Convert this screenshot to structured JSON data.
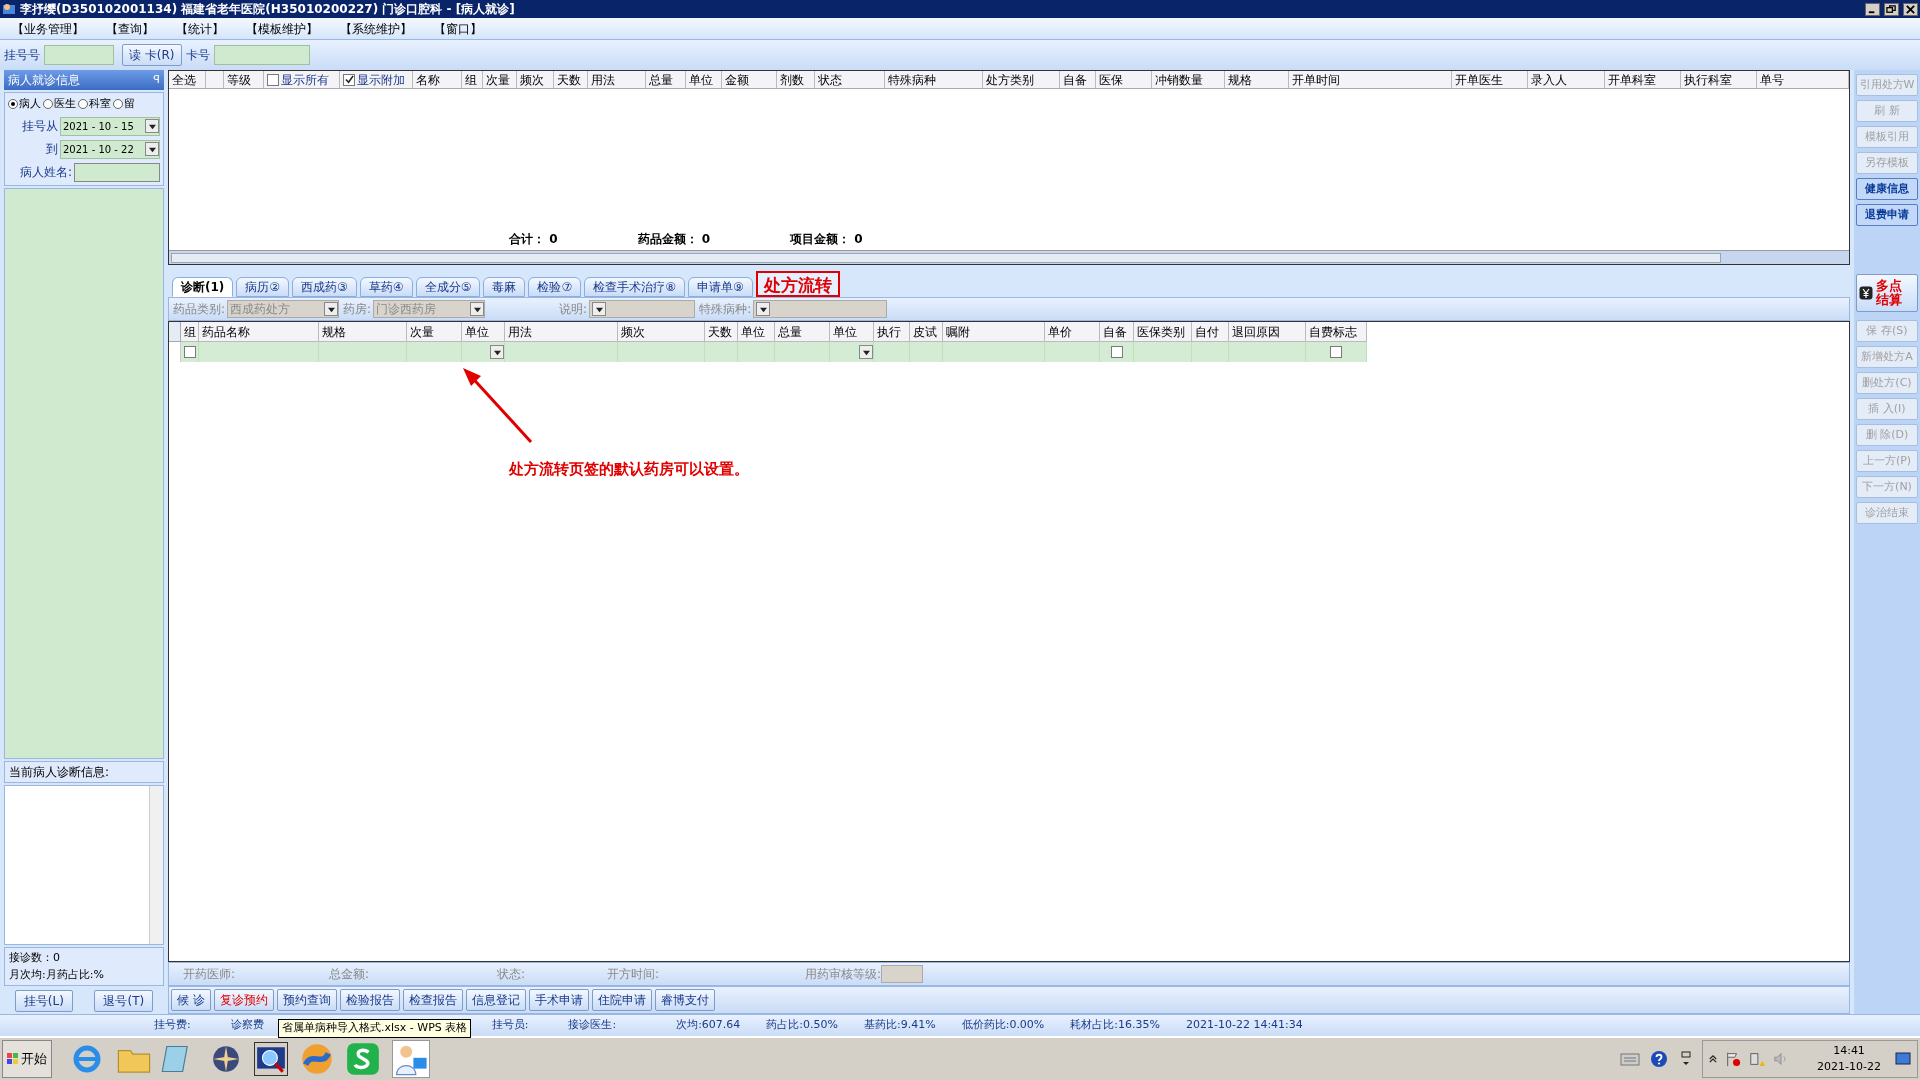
{
  "window": {
    "title": "李抒缨(D350102001134) 福建省老年医院(H35010200227) 门诊口腔科 - [病人就诊]"
  },
  "menu": [
    "【业务管理】",
    "【查询】",
    "【统计】",
    "【模板维护】",
    "【系统维护】",
    "【窗口】"
  ],
  "toolbar": {
    "reg_label": "挂号号",
    "read_card": "读 卡(R)",
    "card_label": "卡号"
  },
  "left_panel": {
    "title": "病人就诊信息",
    "pin": "ꟼ",
    "radios": [
      {
        "label": "病人",
        "selected": true
      },
      {
        "label": "医生",
        "selected": false
      },
      {
        "label": "科室",
        "selected": false
      },
      {
        "label": "留",
        "selected": false
      }
    ],
    "date_from_label": "挂号从",
    "date_from": "2021 - 10 - 15",
    "date_to_label": "到",
    "date_to": "2021 - 10 - 22",
    "name_label": "病人姓名:",
    "diag_title": "当前病人诊断信息:",
    "visits": "接诊数：0",
    "monthly": "月次均:月药占比:%",
    "buttons": [
      "挂号(L)",
      "退号(T)"
    ]
  },
  "top_grid": {
    "columns": [
      {
        "label": "全选",
        "kind": "text"
      },
      {
        "kind": "text"
      },
      {
        "label": "等级",
        "kind": "text"
      },
      {
        "label": "显示所有",
        "kind": "checkbox",
        "checked": false
      },
      {
        "label": "显示附加",
        "kind": "checkbox",
        "checked": true
      },
      {
        "label": "名称",
        "kind": "text"
      },
      {
        "label": "组",
        "kind": "text"
      },
      {
        "label": "次量",
        "kind": "text"
      },
      {
        "label": "频次",
        "kind": "text"
      },
      {
        "label": "天数",
        "kind": "text"
      },
      {
        "label": "用法",
        "kind": "text"
      },
      {
        "label": "总量",
        "kind": "text"
      },
      {
        "label": "单位",
        "kind": "text"
      },
      {
        "label": "金额",
        "kind": "text"
      },
      {
        "label": "剂数",
        "kind": "text"
      },
      {
        "label": "状态",
        "kind": "text"
      },
      {
        "label": "特殊病种",
        "kind": "text"
      },
      {
        "label": "处方类别",
        "kind": "text"
      },
      {
        "label": "自备",
        "kind": "text"
      },
      {
        "label": "医保",
        "kind": "text"
      },
      {
        "label": "冲销数量",
        "kind": "text"
      },
      {
        "label": "规格",
        "kind": "text"
      },
      {
        "label": "开单时间",
        "kind": "text"
      },
      {
        "label": "开单医生",
        "kind": "text"
      },
      {
        "label": "录入人",
        "kind": "text"
      },
      {
        "label": "开单科室",
        "kind": "text"
      },
      {
        "label": "执行科室",
        "kind": "text"
      },
      {
        "label": "单号",
        "kind": "text"
      }
    ],
    "totals": [
      "合计： 0",
      "药品金额： 0",
      "项目金额： 0"
    ]
  },
  "tabs": [
    {
      "label": "诊断(1)",
      "selected": true,
      "kind": "tab"
    },
    {
      "label": "病历②",
      "selected": false,
      "kind": "tab"
    },
    {
      "label": "西成药③",
      "selected": false,
      "kind": "tab"
    },
    {
      "label": "草药④",
      "selected": false,
      "kind": "tab"
    },
    {
      "label": "全成分⑤",
      "selected": false,
      "kind": "tab"
    },
    {
      "label": "毒麻",
      "selected": false,
      "kind": "tab"
    },
    {
      "label": "检验⑦",
      "selected": false,
      "kind": "tab"
    },
    {
      "label": "检查手术治疗⑧",
      "selected": false,
      "kind": "tab"
    },
    {
      "label": "申请单⑨",
      "selected": false,
      "kind": "tab"
    },
    {
      "label": "处方流转",
      "selected": false,
      "kind": "highlight"
    }
  ],
  "filters": [
    {
      "label": "药品类别:",
      "value": "西成药处方"
    },
    {
      "label": "药房:",
      "value": "门诊西药房"
    },
    {
      "label": "说明:"
    },
    {
      "label": "特殊病种:"
    }
  ],
  "drug_grid": {
    "columns": [
      "组",
      "药品名称",
      "规格",
      "次量",
      "单位",
      "用法",
      "频次",
      "天数",
      "单位",
      "总量",
      "单位",
      "执行",
      "皮试",
      "嘱附",
      "单价",
      "自备",
      "医保类别",
      "自付",
      "退回原因",
      "自费标志"
    ],
    "rows": [
      {
        "cells": [
          {
            "kind": "checkbox",
            "checked": false
          },
          {
            "kind": "blank"
          },
          {
            "kind": "blank"
          },
          {
            "kind": "blank"
          },
          {
            "kind": "dropdown"
          },
          {
            "kind": "blank"
          },
          {
            "kind": "blank"
          },
          {
            "kind": "blank"
          },
          {
            "kind": "blank"
          },
          {
            "kind": "blank"
          },
          {
            "kind": "dropdown"
          },
          {
            "kind": "blank"
          },
          {
            "kind": "blank"
          },
          {
            "kind": "blank"
          },
          {
            "kind": "blank"
          },
          {
            "kind": "checkbox",
            "checked": false
          },
          {
            "kind": "blank"
          },
          {
            "kind": "blank"
          },
          {
            "kind": "blank"
          },
          {
            "kind": "checkbox",
            "checked": false
          }
        ]
      }
    ]
  },
  "annotation": "处方流转页签的默认药房可以设置。",
  "info_row": [
    "开药医师:",
    "总金额:",
    "状态:",
    "开方时间:",
    "用药审核等级:"
  ],
  "bottom_buttons": [
    {
      "label": "候 诊",
      "kind": "normal"
    },
    {
      "label": "复诊预约",
      "kind": "alert"
    },
    {
      "label": "预约查询",
      "kind": "normal"
    },
    {
      "label": "检验报告",
      "kind": "normal"
    },
    {
      "label": "检查报告",
      "kind": "normal"
    },
    {
      "label": "信息登记",
      "kind": "normal"
    },
    {
      "label": "手术申请",
      "kind": "normal"
    },
    {
      "label": "住院申请",
      "kind": "normal"
    },
    {
      "label": "睿博支付",
      "kind": "normal"
    }
  ],
  "side_buttons": [
    {
      "label": "引用处方W",
      "kind": "button",
      "disabled": true
    },
    {
      "label": "刷 新",
      "kind": "button",
      "disabled": true
    },
    {
      "label": "模板引用",
      "kind": "button",
      "disabled": true
    },
    {
      "label": "另存模板",
      "kind": "button",
      "disabled": true
    },
    {
      "label": "健康信息",
      "kind": "button",
      "disabled": false
    },
    {
      "label": "退费申请",
      "kind": "button",
      "disabled": false
    },
    {
      "label": "多点结算",
      "kind": "settle",
      "disabled": false
    },
    {
      "label": "保 存(S)",
      "kind": "button",
      "disabled": true
    },
    {
      "label": "新增处方A",
      "kind": "button",
      "disabled": true
    },
    {
      "label": "删处方(C)",
      "kind": "button",
      "disabled": true
    },
    {
      "label": "插 入(I)",
      "kind": "button",
      "disabled": true
    },
    {
      "label": "删 除(D)",
      "kind": "button",
      "disabled": true
    },
    {
      "label": "上一方(P)",
      "kind": "button",
      "disabled": true
    },
    {
      "label": "下一方(N)",
      "kind": "button",
      "disabled": true
    },
    {
      "label": "诊治结束",
      "kind": "button",
      "disabled": true
    }
  ],
  "status_bar": [
    "挂号费:",
    "诊察费",
    "挂号员:",
    "接诊医生:",
    "次均:607.64",
    "药占比:0.50%",
    "基药比:9.41%",
    "低价药比:0.00%",
    "耗材占比:16.35%",
    "2021-10-22 14:41:34"
  ],
  "tooltip": "省属单病种导入格式.xlsx - WPS 表格",
  "taskbar": {
    "start": "开始",
    "time": "14:41",
    "date": "2021-10-22"
  }
}
